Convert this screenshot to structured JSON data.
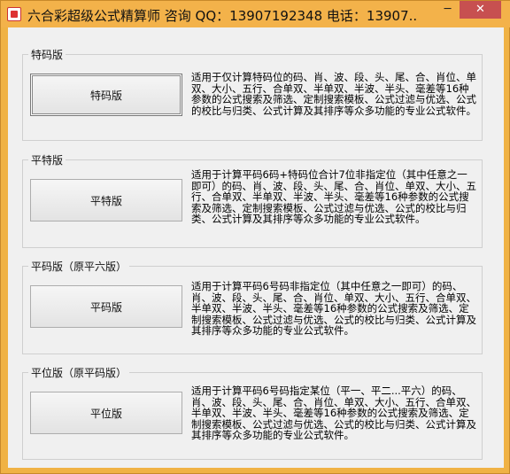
{
  "window": {
    "title": "六合彩超级公式精算师 咨询 QQ：13907192348 电话：13907...",
    "minimize_glyph": "─",
    "close_glyph": "✕"
  },
  "groups": [
    {
      "label": "特码版",
      "button": "特码版",
      "description": "适用于仅计算特码位的码、肖、波、段、头、尾、合、肖位、单双、大小、五行、合单双、半单双、半波、半头、毫差等16种参数的公式搜索及筛选、定制搜索模板、公式过滤与优选、公式的校比与归类、公式计算及其排序等众多功能的专业公式软件。"
    },
    {
      "label": "平特版",
      "button": "平特版",
      "description": "适用于计算平码6码+特码位合计7位非指定位（其中任意之一即可）的码、肖、波、段、头、尾、合、肖位、单双、大小、五行、合单双、半单双、半波、半头、毫差等16种参数的公式搜索及筛选、定制搜索模板、公式过滤与优选、公式的校比与归类、公式计算及其排序等众多功能的专业公式软件。"
    },
    {
      "label": "平码版（原平六版）",
      "button": "平码版",
      "description": "适用于计算平码6号码非指定位（其中任意之一即可）的码、肖、波、段、头、尾、合、肖位、单双、大小、五行、合单双、半单双、半波、半头、毫差等16种参数的公式搜索及筛选、定制搜索模板、公式过滤与优选、公式的校比与归类、公式计算及其排序等众多功能的专业公式软件。"
    },
    {
      "label": "平位版（原平码版）",
      "button": "平位版",
      "description": "适用于计算平码6号码指定某位（平一、平二...平六）的码、肖、波、段、头、尾、合、肖位、单双、大小、五行、合单双、半单双、半波、半头、毫差等16种参数的公式搜索及筛选、定制搜索模板、公式过滤与优选、公式的校比与归类、公式计算及其排序等众多功能的专业公式软件。"
    }
  ]
}
